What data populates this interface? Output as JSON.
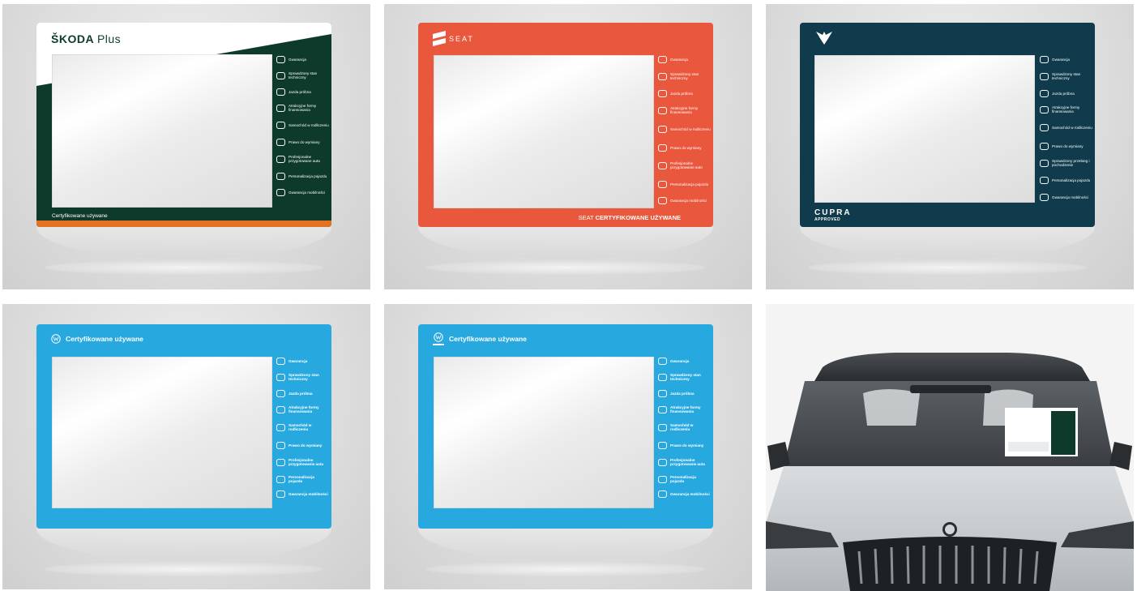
{
  "colors": {
    "skoda_green": "#0e3a2c",
    "skoda_orange": "#e37222",
    "seat_orange": "#e9573d",
    "cupra_teal": "#0f3b4c",
    "vw_blue": "#27a9e0",
    "skoda_car_silver": "#c9cdd0"
  },
  "skoda": {
    "brand": "ŠKODA",
    "brand_suffix": "Plus",
    "footer": "Certyfikowane używane",
    "features": [
      "Gwarancja",
      "Sprawdzony stan techniczny",
      "Jazda próbna",
      "Atrakcyjne formy finansowania",
      "Samochód w rodliczeniu",
      "Prawo do wymiany",
      "Profesjonalne przygotowane auta",
      "Personalizacja pojazdu",
      "Gwarancja mobilności"
    ]
  },
  "seat": {
    "brand": "SEAT",
    "footer_prefix": "SEAT",
    "footer_bold": "CERTYFIKOWANE UŻYWANE",
    "features": [
      "Gwarancja",
      "Sprawdzony stan techniczny",
      "Jazda próbna",
      "Atrakcyjne formy finansowania",
      "Samochód w rodliczeniu",
      "Prawo do wymiany",
      "Profesjonalne przygotowanie auto",
      "Personalizacja pojazdu",
      "Gwarancja mobilności"
    ]
  },
  "cupra": {
    "brand": "CUPRA",
    "brand_sub": "APPROVED",
    "features": [
      "Gwarancja",
      "Sprawdzony stan techniczny",
      "Jazda próbna",
      "Atrakcyjne formy finansowania",
      "Samochód w rodliczeniu",
      "Prawo do wymiany",
      "Sprawdzony przebieg i pochodzenie",
      "Personalizacja pojazdu",
      "Gwarancja mobilności"
    ]
  },
  "vw1": {
    "title": "Certyfikowane używane",
    "features": [
      "Gwarancja",
      "Sprawdzony stan techniczny",
      "Jazda próbna",
      "Atrakcyjne formy finansowania",
      "Samochód w rodliczeniu",
      "Prawo do wymiany",
      "Profesjonalne przygotowanie auta",
      "Personalizacja pojazdu",
      "Gwarancja mobilności"
    ]
  },
  "vw2": {
    "title": "Certyfikowane używane",
    "features": [
      "Gwarancja",
      "Sprawdzony stan techniczny",
      "Jazda próbna",
      "Atrakcyjne formy finansowania",
      "Samochód w rodliczeniu",
      "Prawo do wymiany",
      "Profesjonalne przygotowanie auta",
      "Personalizacja pojazdu",
      "Gwarancja mobilności"
    ]
  },
  "icons": [
    "shield-icon",
    "car-check-icon",
    "steering-wheel-icon",
    "coin-icon",
    "car-swap-icon",
    "exchange-arrows-icon",
    "document-icon",
    "car-custom-icon",
    "car-mobility-icon"
  ]
}
